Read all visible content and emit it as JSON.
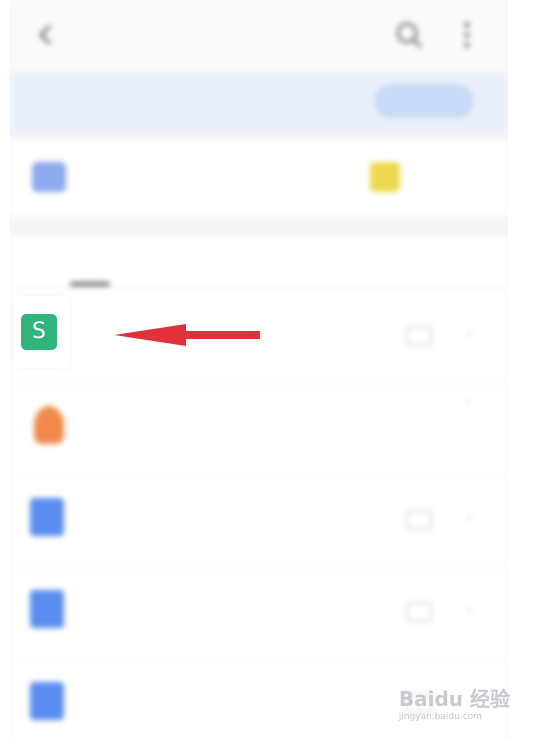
{
  "header": {
    "title": "",
    "back_icon": "back-arrow-icon",
    "search_icon": "search-icon",
    "more_icon": "more-vertical-icon"
  },
  "banner": {
    "line1": "",
    "line2": "",
    "button_label": "",
    "close_symbol": ""
  },
  "quick_access": {
    "left_label": "",
    "right_label": ""
  },
  "tabs": [
    {
      "label": ""
    },
    {
      "label": ""
    },
    {
      "label": ""
    }
  ],
  "files": [
    {
      "title": "",
      "subtitle": "",
      "icon_color": "#2fb57a",
      "icon": "wps-spreadsheet-icon"
    },
    {
      "title": "",
      "subtitle": "",
      "icon_color": "#f08a4b",
      "icon": "orange-file-icon"
    },
    {
      "title": "",
      "subtitle": "",
      "icon_color": "#5b8def",
      "icon": "doc-file-icon"
    },
    {
      "title": "",
      "subtitle": "",
      "icon_color": "#5b8def",
      "icon": "doc-file-icon"
    },
    {
      "title": "",
      "subtitle": "",
      "icon_color": "#5b8def",
      "icon": "doc-file-icon"
    }
  ],
  "highlight": {
    "app_icon_letter": "S",
    "app_icon_color": "#2fb57a",
    "arrow_color": "#e0303a"
  },
  "watermark": {
    "brand": "Baidu 经验",
    "url": "jingyan.baidu.com"
  },
  "colors": {
    "accent_blue": "#5b8def",
    "banner_bg": "#eaf0fb",
    "folder_yellow": "#ecd84e"
  }
}
